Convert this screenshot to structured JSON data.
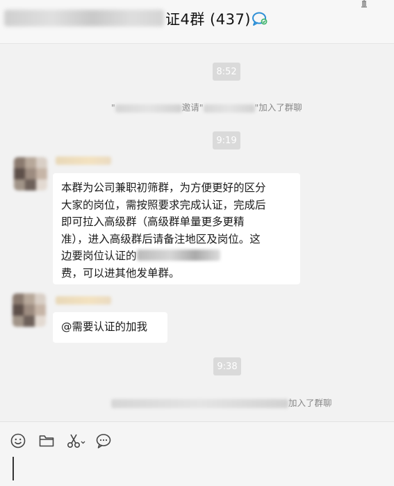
{
  "header": {
    "title_suffix": "证4群 (437)",
    "chat_icon": "chat-bubble-icon",
    "pin_icon": "pin-icon"
  },
  "messages": {
    "time1": "8:52",
    "sys1": {
      "middle": "邀请",
      "quote_open": "\"",
      "quote_close": "\"",
      "suffix": "加入了群聊"
    },
    "time2": "9:19",
    "msg1": {
      "lines": [
        "本群为公司兼职初筛群，为方便更好的区分",
        "大家的岗位，需按照要求完成认证，完成后",
        "即可拉入高级群（高级群单量更多更精",
        "准），进入高级群后请备注地区及岗位。这",
        "边要岗位认证的",
        "费，可以进其他发单群。"
      ]
    },
    "msg2": {
      "text": "@需要认证的加我"
    },
    "time3": "9:38",
    "sys2": {
      "suffix": "加入了群聊"
    }
  },
  "toolbar": {
    "icons": [
      "emoji-icon",
      "folder-icon",
      "scissors-icon",
      "chat-history-icon"
    ]
  },
  "colors": {
    "background": "#f2f2f2",
    "bubble": "#ffffff",
    "time_pill": "#dadada",
    "system_text": "#888888"
  }
}
